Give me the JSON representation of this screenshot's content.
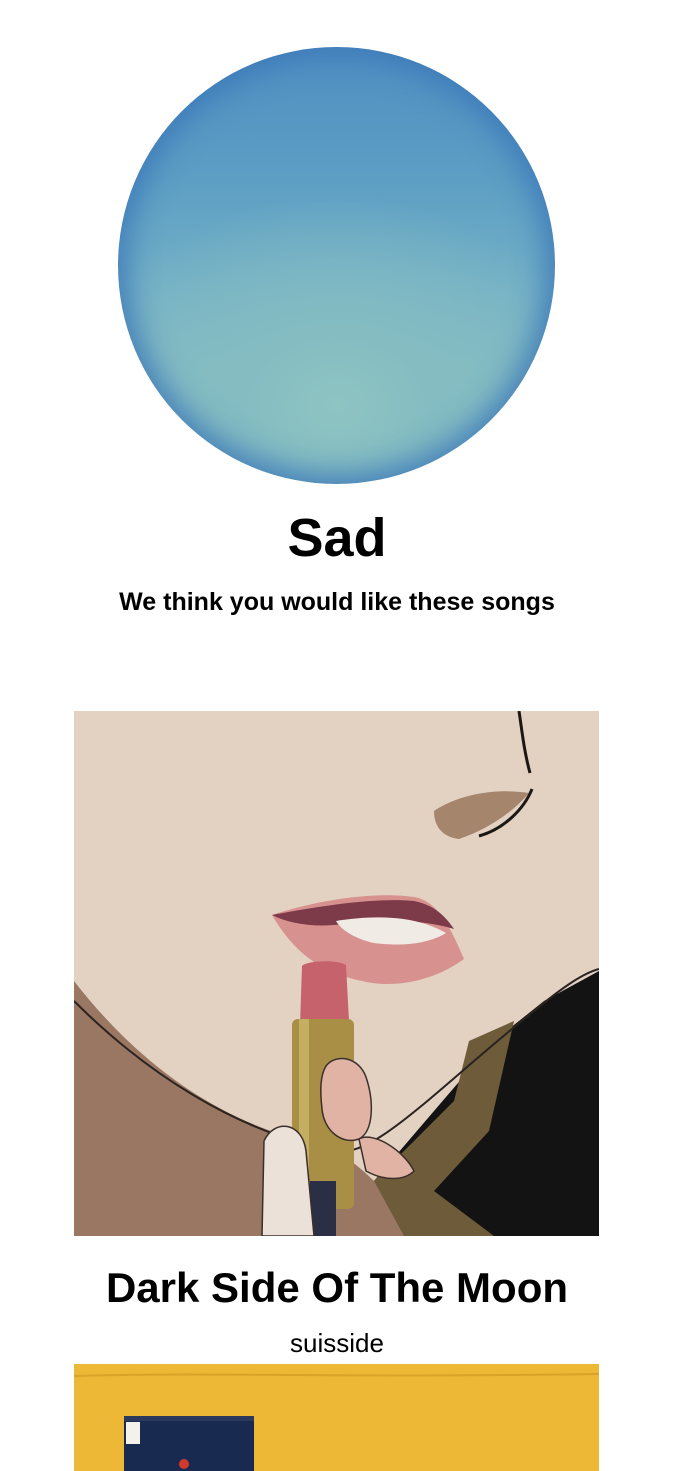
{
  "mood": {
    "name": "Sad",
    "subtitle": "We think you would like these songs",
    "orb_colors": {
      "top": "#4f8fc2",
      "bottom": "#8cc3c2",
      "edge": "#3c78b9"
    }
  },
  "songs": [
    {
      "title": "Dark Side Of The Moon",
      "artist": "suisside",
      "cover_icon": "album-art-lipstick"
    },
    {
      "title": "",
      "artist": "",
      "cover_icon": "album-art-yellow"
    }
  ]
}
